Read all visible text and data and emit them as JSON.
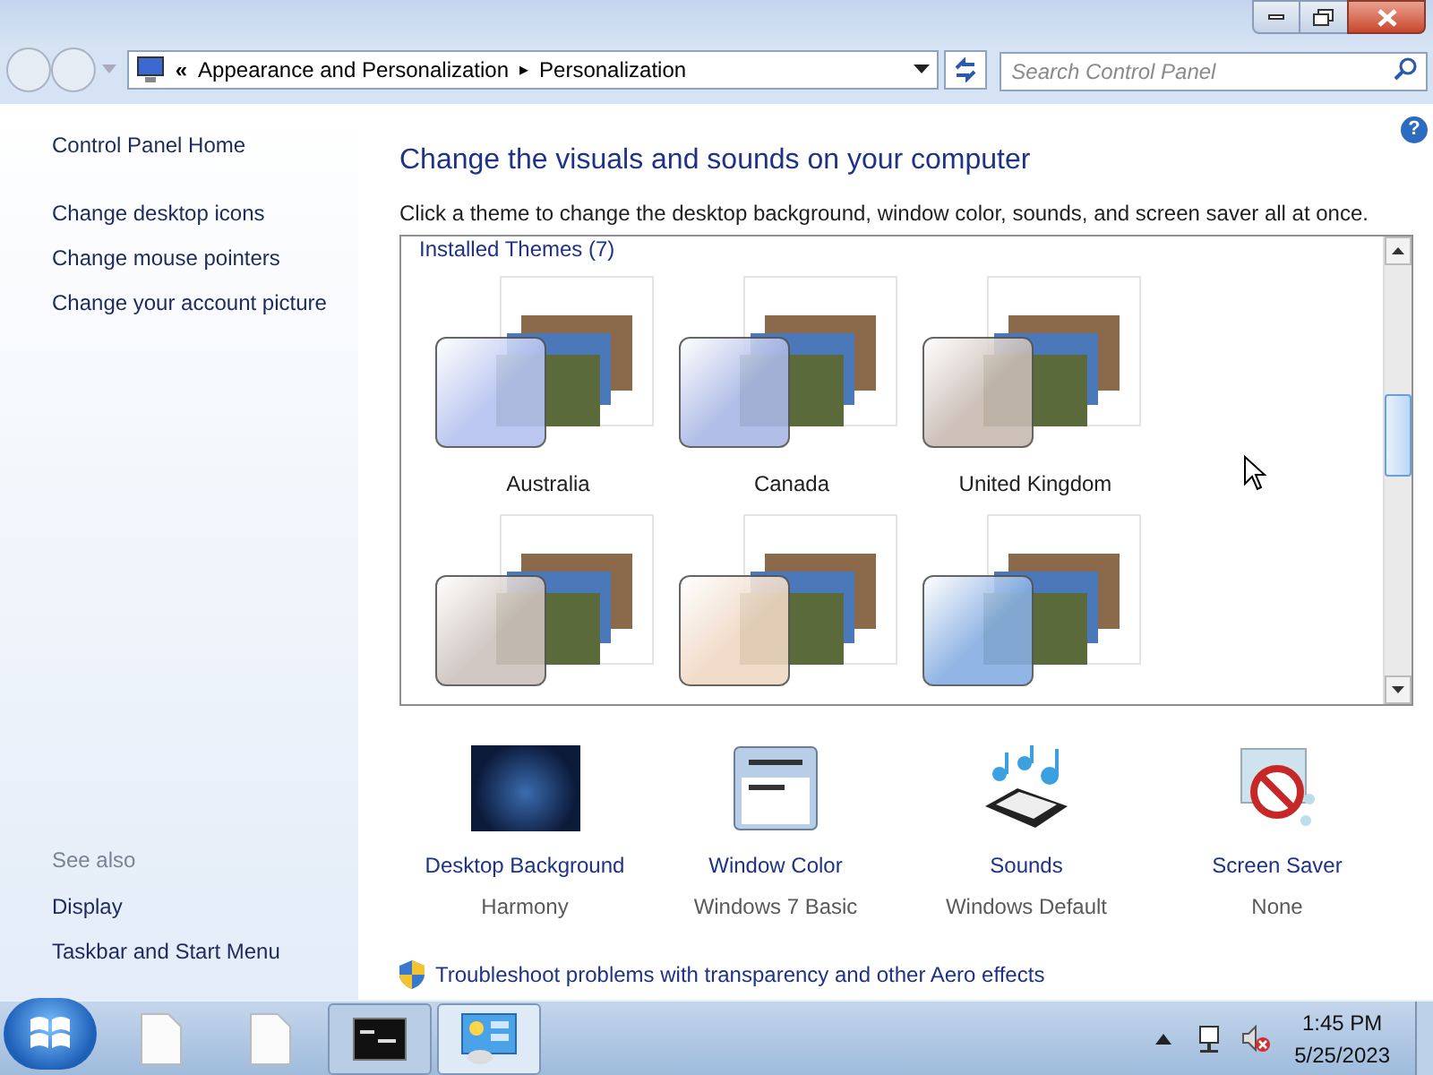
{
  "address": {
    "crumbs": [
      "Appearance and Personalization",
      "Personalization"
    ],
    "overflow": "«",
    "separator": "▸"
  },
  "search": {
    "placeholder": "Search Control Panel"
  },
  "sidebar": {
    "home": "Control Panel Home",
    "links": [
      "Change desktop icons",
      "Change mouse pointers",
      "Change your account picture"
    ],
    "see_also_heading": "See also",
    "see_also": [
      "Display",
      "Taskbar and Start Menu"
    ]
  },
  "help": "?",
  "heading": "Change the visuals and sounds on your computer",
  "description": "Click a theme to change the desktop background, window color, sounds, and screen saver all at once.",
  "themes_group": "Installed Themes (7)",
  "themes": [
    {
      "name": "Australia",
      "color": "#b4c2f0"
    },
    {
      "name": "Canada",
      "color": "#a9b7e6"
    },
    {
      "name": "United Kingdom",
      "color": "#c8bab2"
    },
    {
      "color": "#cdc2bd"
    },
    {
      "color": "#f0d8c4"
    },
    {
      "color": "#86aee2"
    }
  ],
  "settings": [
    {
      "kind": "background",
      "label": "Desktop Background",
      "value": "Harmony"
    },
    {
      "kind": "window_color",
      "label": "Window Color",
      "value": "Windows 7 Basic"
    },
    {
      "kind": "sounds",
      "label": "Sounds",
      "value": "Windows Default"
    },
    {
      "kind": "screen_saver",
      "label": "Screen Saver",
      "value": "None"
    }
  ],
  "troubleshoot": "Troubleshoot problems with transparency and other Aero effects",
  "taskbar": {
    "items": [
      {
        "kind": "file",
        "open": false,
        "selected": false
      },
      {
        "kind": "file",
        "open": false,
        "selected": false
      },
      {
        "kind": "console",
        "open": true,
        "selected": false
      },
      {
        "kind": "control_panel",
        "open": true,
        "selected": true
      }
    ],
    "time": "1:45 PM",
    "date": "5/25/2023"
  }
}
